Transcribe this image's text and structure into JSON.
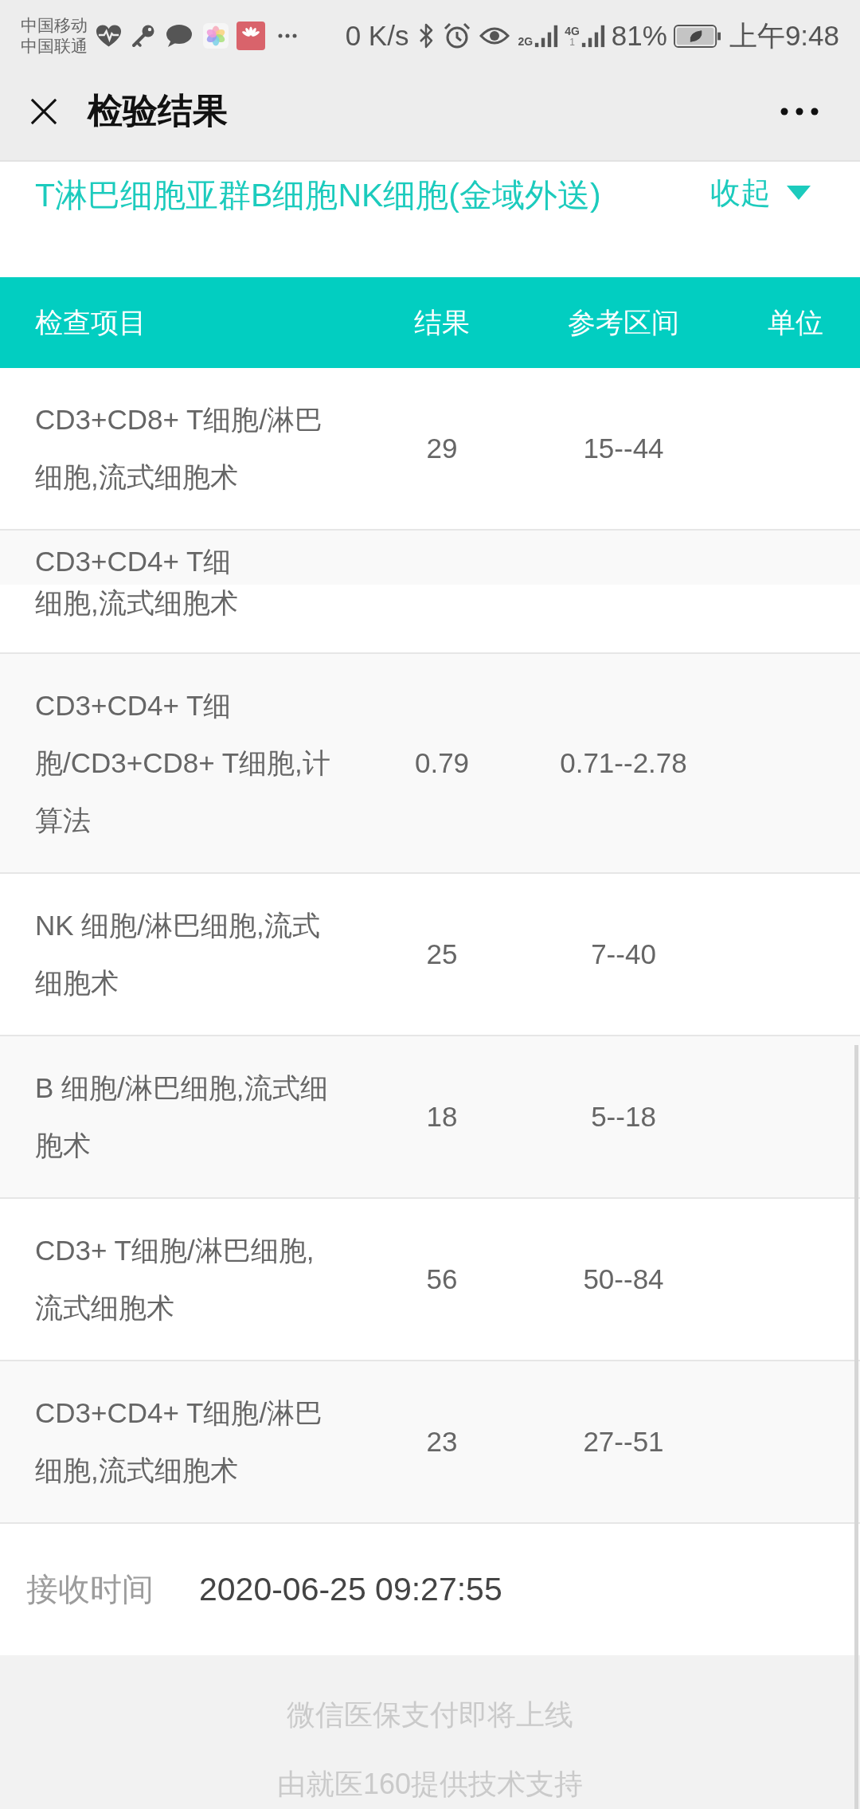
{
  "status_bar": {
    "carriers": [
      "中国移动",
      "中国联通"
    ],
    "net_speed": "0 K/s",
    "networks": [
      {
        "label": "2G"
      },
      {
        "label": "4G",
        "sim": "1"
      }
    ],
    "battery": "81%",
    "time": "上午9:48"
  },
  "nav": {
    "title": "检验结果"
  },
  "report": {
    "title": "T淋巴细胞亚群B细胞NK细胞(金域外送)",
    "toggle": "收起",
    "expanded": true
  },
  "table": {
    "columns": [
      "检查项目",
      "结果",
      "参考区间",
      "单位"
    ],
    "rows": [
      {
        "kind": "full",
        "name_lines": [
          "CD3+CD8+ T细胞/淋巴",
          "细胞,流式细胞术"
        ],
        "result": "29",
        "range": "15--44"
      },
      {
        "kind": "clipped",
        "name_lines": [
          "CD3+CD4+ T细",
          "细胞,流式细胞术"
        ]
      },
      {
        "kind": "full",
        "name_lines": [
          "CD3+CD4+ T细",
          "胞/CD3+CD8+ T细胞,计",
          "算法"
        ],
        "result": "0.79",
        "range": "0.71--2.78"
      },
      {
        "kind": "full",
        "name_lines": [
          "NK 细胞/淋巴细胞,流式",
          "细胞术"
        ],
        "result": "25",
        "range": "7--40"
      },
      {
        "kind": "full",
        "name_lines": [
          "B 细胞/淋巴细胞,流式细",
          "胞术"
        ],
        "result": "18",
        "range": "5--18"
      },
      {
        "kind": "full",
        "name_lines": [
          "CD3+ T细胞/淋巴细胞,",
          "流式细胞术"
        ],
        "result": "56",
        "range": "50--84"
      },
      {
        "kind": "full",
        "name_lines": [
          "CD3+CD4+ T细胞/淋巴",
          "细胞,流式细胞术"
        ],
        "result": "23",
        "range": "27--51"
      }
    ]
  },
  "received": {
    "label": "接收时间",
    "value": "2020-06-25 09:27:55"
  },
  "footer": [
    "微信医保支付即将上线",
    "由就医160提供技术支持"
  ]
}
